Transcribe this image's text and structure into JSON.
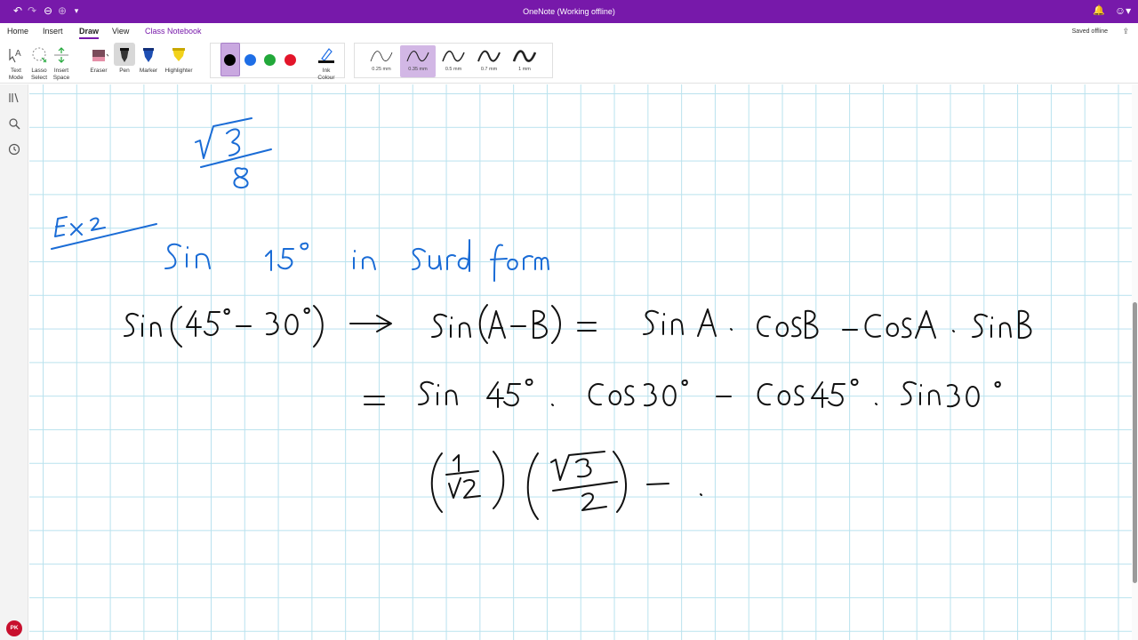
{
  "window": {
    "title": "OneNote (Working offline)"
  },
  "menu": {
    "tabs": [
      "Home",
      "Insert",
      "Draw",
      "View",
      "Class Notebook"
    ],
    "active": "Draw",
    "saved_status": "Saved offline"
  },
  "ribbon": {
    "text_mode": [
      "Text",
      "Mode"
    ],
    "lasso_select": [
      "Lasso",
      "Select"
    ],
    "insert_space": [
      "Insert",
      "Space"
    ],
    "eraser": "Eraser",
    "pen": "Pen",
    "marker": "Marker",
    "highlighter": "Highlighter",
    "ink_colour": [
      "Ink",
      "Colour"
    ],
    "colors": [
      "#000000",
      "#1e6ee6",
      "#22a83a",
      "#e3152a"
    ],
    "thickness": [
      "0.25 mm",
      "0.35 mm",
      "0.5 mm",
      "0.7 mm",
      "1 mm"
    ],
    "selected_thickness": "0.35 mm"
  },
  "user": {
    "initials": "PK"
  },
  "ink_colors": {
    "blue": "#1a6cd6",
    "black": "#111111"
  }
}
